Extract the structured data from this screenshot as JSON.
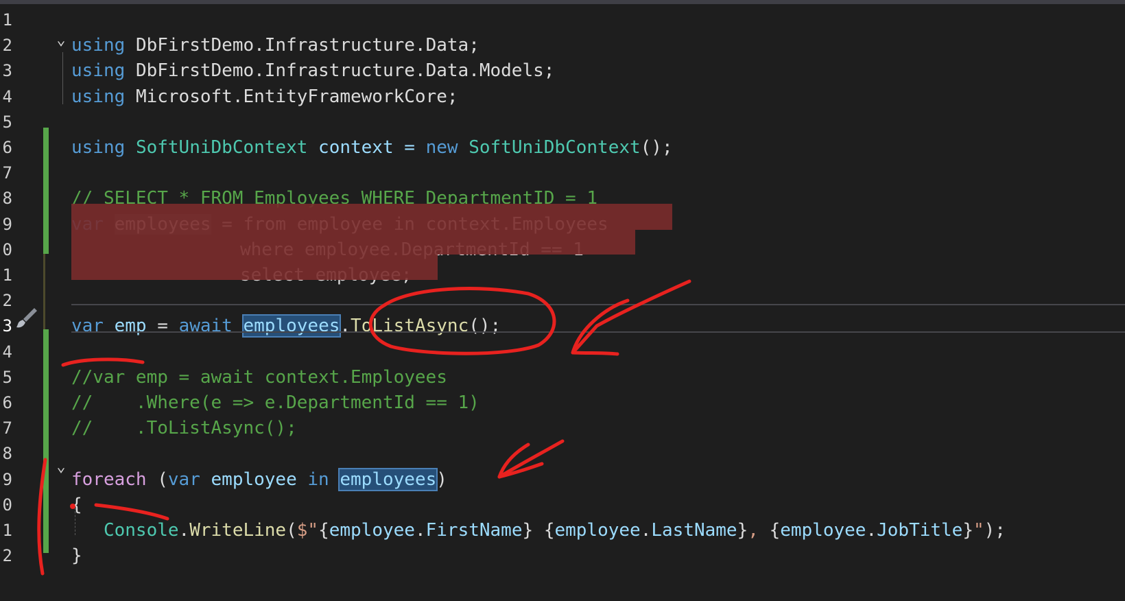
{
  "editor": {
    "line_numbers": [
      "1",
      "2",
      "3",
      "4",
      "5",
      "6",
      "7",
      "8",
      "9",
      "0",
      "1",
      "2",
      "3",
      "4",
      "5",
      "6",
      "7",
      "8",
      "9",
      "0",
      "1",
      "2"
    ],
    "lines": [
      [],
      [
        {
          "t": "using",
          "c": "kw"
        },
        {
          "t": " ",
          "c": "plain"
        },
        {
          "t": "DbFirstDemo.Infrastructure.Data;",
          "c": "plain"
        }
      ],
      [
        {
          "t": "using",
          "c": "kw"
        },
        {
          "t": " ",
          "c": "plain"
        },
        {
          "t": "DbFirstDemo.Infrastructure.Data.Models;",
          "c": "plain"
        }
      ],
      [
        {
          "t": "using",
          "c": "kw"
        },
        {
          "t": " ",
          "c": "plain"
        },
        {
          "t": "Microsoft.EntityFrameworkCore;",
          "c": "plain"
        }
      ],
      [],
      [
        {
          "t": "using",
          "c": "kw"
        },
        {
          "t": " ",
          "c": "plain"
        },
        {
          "t": "SoftUniDbContext",
          "c": "ty"
        },
        {
          "t": " context = ",
          "c": "id"
        },
        {
          "t": "new",
          "c": "kw"
        },
        {
          "t": " ",
          "c": "plain"
        },
        {
          "t": "SoftUniDbContext",
          "c": "ty"
        },
        {
          "t": "();",
          "c": "plain"
        }
      ],
      [],
      [
        {
          "t": "// SELECT * FROM Employees WHERE DepartmentID = 1",
          "c": "cm"
        }
      ],
      [
        {
          "t": "var",
          "c": "kw"
        },
        {
          "t": " ",
          "c": "plain"
        },
        {
          "t": "employees",
          "c": "plain",
          "h": "soft"
        },
        {
          "t": " = from employee in context.Employees",
          "c": "plain"
        }
      ],
      [
        {
          "t": "          where employee.DepartmentId == 1",
          "c": "plain"
        }
      ],
      [
        {
          "t": "          select employee;",
          "c": "plain"
        }
      ],
      [],
      [
        {
          "t": "var",
          "c": "kw"
        },
        {
          "t": " ",
          "c": "plain"
        },
        {
          "t": "emp",
          "c": "id"
        },
        {
          "t": " = ",
          "c": "plain"
        },
        {
          "t": "await",
          "c": "kw"
        },
        {
          "t": " ",
          "c": "plain"
        },
        {
          "t": "employees",
          "c": "id",
          "h": "word"
        },
        {
          "t": ".",
          "c": "plain"
        },
        {
          "t": "ToListAsync",
          "c": "fn"
        },
        {
          "t": "();",
          "c": "plain"
        }
      ],
      [],
      [
        {
          "t": "//var emp = await context.Employees",
          "c": "cm"
        }
      ],
      [
        {
          "t": "//    .Where(e => e.DepartmentId == 1)",
          "c": "cm"
        }
      ],
      [
        {
          "t": "//    .ToListAsync();",
          "c": "cm"
        }
      ],
      [],
      [
        {
          "t": "foreach",
          "c": "kw2"
        },
        {
          "t": " (",
          "c": "plain"
        },
        {
          "t": "var",
          "c": "kw"
        },
        {
          "t": " ",
          "c": "plain"
        },
        {
          "t": "employee",
          "c": "id"
        },
        {
          "t": " ",
          "c": "plain"
        },
        {
          "t": "in",
          "c": "kw"
        },
        {
          "t": " ",
          "c": "plain"
        },
        {
          "t": "employees",
          "c": "id",
          "h": "word"
        },
        {
          "t": ")",
          "c": "plain"
        }
      ],
      [
        {
          "t": "{",
          "c": "plain"
        }
      ],
      [
        {
          "t": "   ",
          "c": "plain"
        },
        {
          "t": "Console",
          "c": "ty"
        },
        {
          "t": ".",
          "c": "plain"
        },
        {
          "t": "WriteLine",
          "c": "fn"
        },
        {
          "t": "(",
          "c": "plain"
        },
        {
          "t": "$\"",
          "c": "str"
        },
        {
          "t": "{",
          "c": "plain"
        },
        {
          "t": "employee",
          "c": "id"
        },
        {
          "t": ".",
          "c": "plain"
        },
        {
          "t": "FirstName",
          "c": "id"
        },
        {
          "t": "}",
          "c": "plain"
        },
        {
          "t": " ",
          "c": "str"
        },
        {
          "t": "{",
          "c": "plain"
        },
        {
          "t": "employee",
          "c": "id"
        },
        {
          "t": ".",
          "c": "plain"
        },
        {
          "t": "LastName",
          "c": "id"
        },
        {
          "t": "}",
          "c": "plain"
        },
        {
          "t": ", ",
          "c": "str"
        },
        {
          "t": "{",
          "c": "plain"
        },
        {
          "t": "employee",
          "c": "id"
        },
        {
          "t": ".",
          "c": "plain"
        },
        {
          "t": "JobTitle",
          "c": "id"
        },
        {
          "t": "}",
          "c": "plain"
        },
        {
          "t": "\"",
          "c": "str"
        },
        {
          "t": ");",
          "c": "plain"
        }
      ],
      [
        {
          "t": "}",
          "c": "plain"
        }
      ]
    ]
  },
  "colors": {
    "background": "#1e1e1e",
    "keyword": "#569cd6",
    "control_keyword": "#d8a0df",
    "type": "#4ec9b0",
    "comment": "#57a64a",
    "selection": "#7a2b2b",
    "annotation_ink": "#e8221f"
  },
  "icons": {
    "gutter": "paintbrush-icon",
    "fold": "chevron-down-icon"
  }
}
